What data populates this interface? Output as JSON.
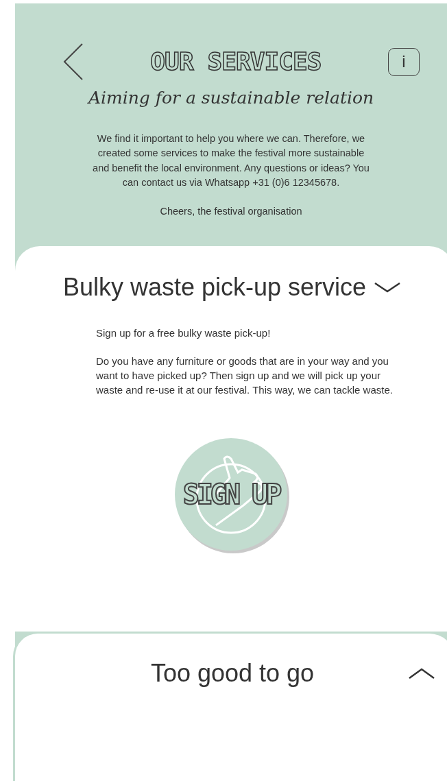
{
  "header": {
    "title": "OUR SERVICES",
    "subtitle": "Aiming for a sustainable relation",
    "info_label": "i",
    "intro": [
      "We find it important to help you where we can. Therefore, we created some services to make the festival more sustainable and benefit the local environment. Any questions or ideas? You can contact us via Whatsapp +31 (0)6 12345678.",
      "Cheers, the festival organisation"
    ]
  },
  "sections": [
    {
      "title": "Bulky waste pick-up service",
      "expanded": true,
      "paragraphs": [
        "Sign up for a free bulky waste pick-up!",
        "Do you have any furniture or goods that are in your way and you want to have picked up? Then sign up and we will pick up your waste and re-use it at our festival. This way, we can tackle waste."
      ],
      "button": "SIGN UP"
    },
    {
      "title": "Too good to go",
      "expanded": false
    }
  ]
}
